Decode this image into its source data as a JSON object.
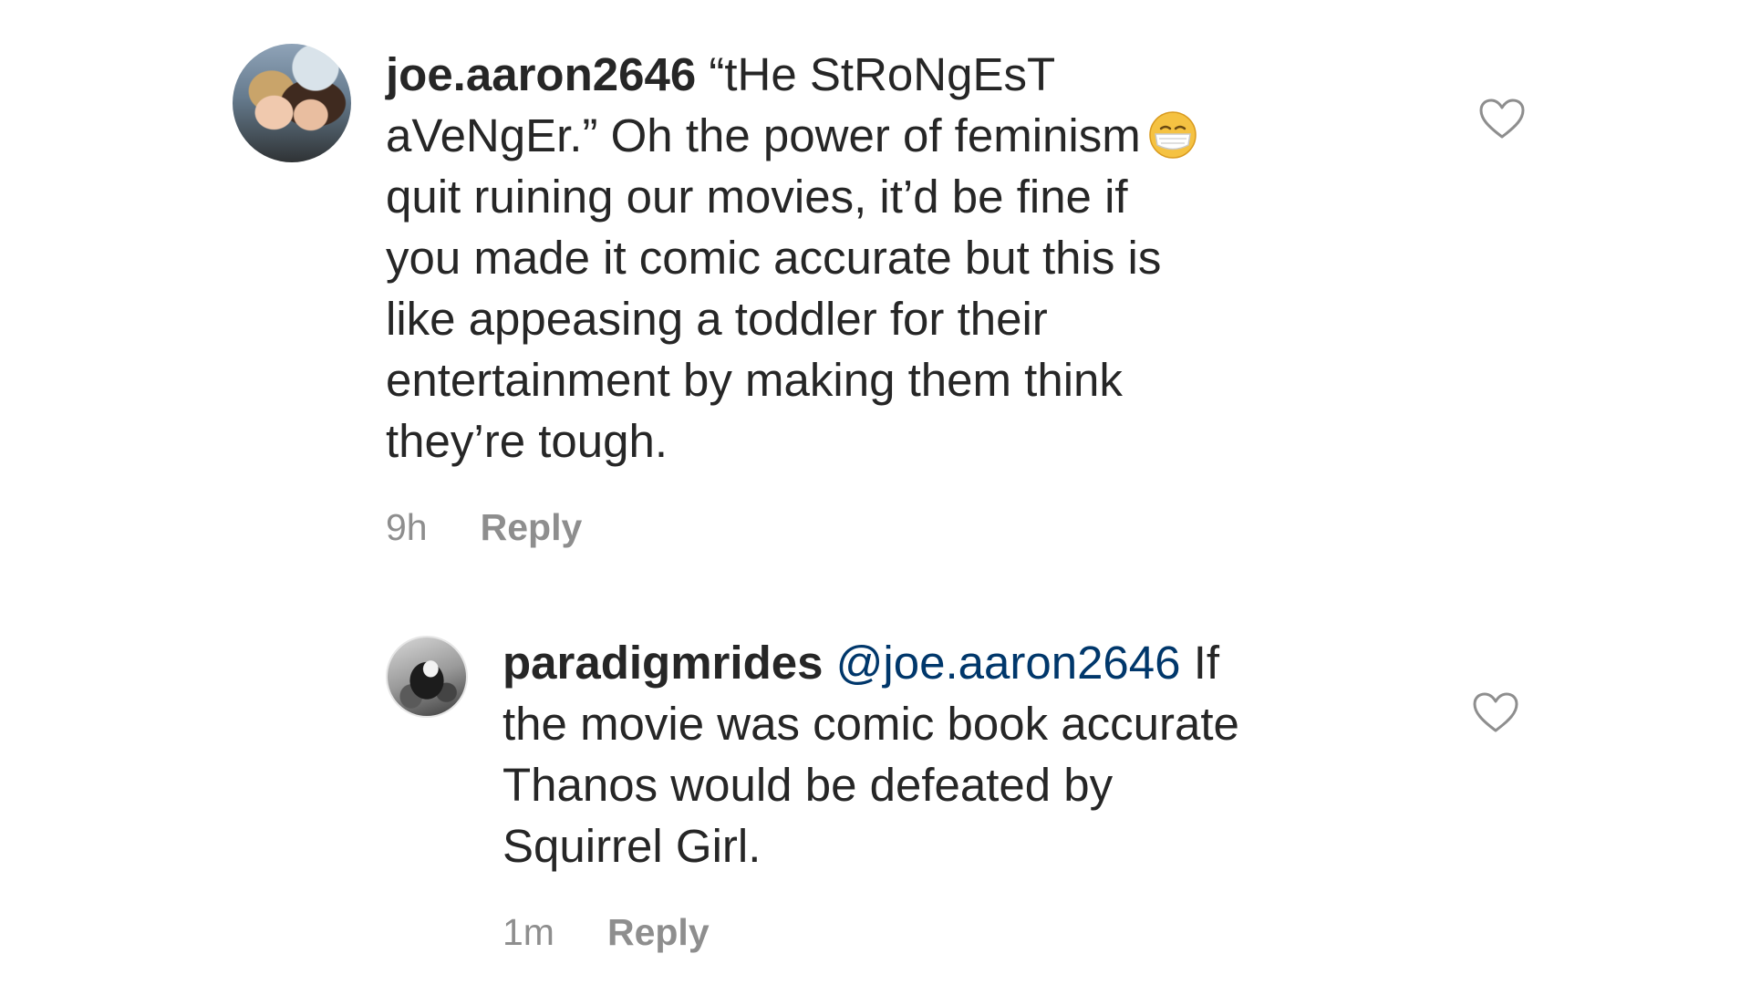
{
  "comments": [
    {
      "username": "joe.aaron2646",
      "mention": "",
      "text": " “tHe StRoNgEsT aVeNgEr.” Oh the power of feminism",
      "emoji": "face-with-medical-mask",
      "text_after_emoji": " quit ruining our movies, it’d be fine if you made it comic accurate but this is like appeasing a toddler for their entertainment by making them think they’re tough.",
      "time": "9h",
      "reply_label": "Reply",
      "like_icon": "heart-outline-icon"
    },
    {
      "username": "paradigmrides",
      "mention": "@joe.aaron2646",
      "text": " If the movie was comic book accurate Thanos would be defeated by Squirrel Girl.",
      "time": "1m",
      "reply_label": "Reply",
      "like_icon": "heart-outline-icon"
    }
  ],
  "colors": {
    "text": "#262626",
    "mention": "#00376b",
    "muted": "#8e8e8e",
    "background": "#ffffff"
  }
}
